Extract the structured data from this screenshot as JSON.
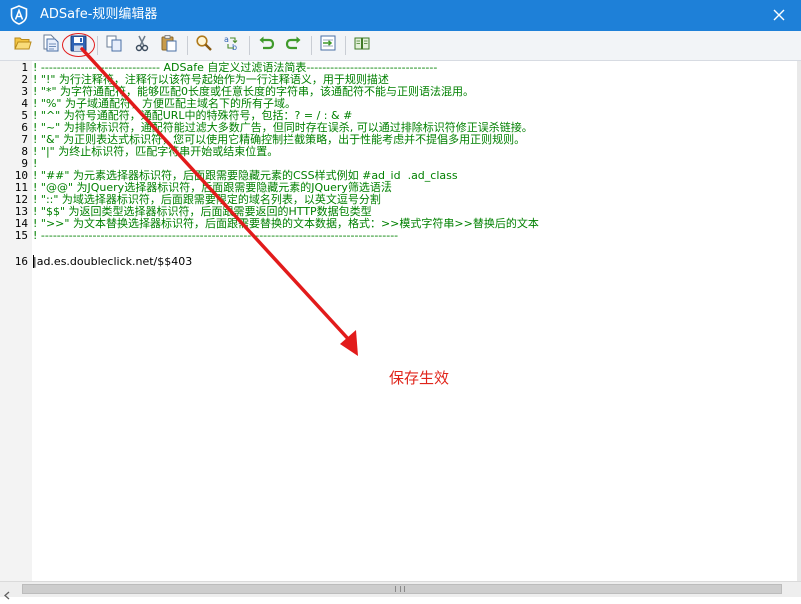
{
  "window": {
    "title": "ADSafe-规则编辑器",
    "titlebar_color": "#1e80d8"
  },
  "toolbar": {
    "buttons": [
      {
        "name": "open-folder-icon"
      },
      {
        "name": "new-document-icon"
      },
      {
        "name": "save-icon"
      },
      {
        "name": "copy-icon"
      },
      {
        "name": "cut-icon"
      },
      {
        "name": "paste-icon"
      },
      {
        "name": "find-icon"
      },
      {
        "name": "replace-icon"
      },
      {
        "name": "undo-icon"
      },
      {
        "name": "redo-icon"
      },
      {
        "name": "goto-line-icon"
      },
      {
        "name": "help-book-icon"
      }
    ]
  },
  "editor": {
    "comment_color": "#008000",
    "text_color": "#000000",
    "lines": [
      {
        "n": "1",
        "text": "! ------------------------------ ADSafe 自定义过滤语法简表---------------------------------"
      },
      {
        "n": "2",
        "text": "! \"!\" 为行注释符，注释行以该符号起始作为一行注释语义，用于规则描述"
      },
      {
        "n": "3",
        "text": "! \"*\" 为字符通配符，能够匹配0长度或任意长度的字符串，该通配符不能与正则语法混用。"
      },
      {
        "n": "4",
        "text": "! \"%\" 为子域通配符，方便匹配主域名下的所有子域。"
      },
      {
        "n": "5",
        "text": "! \"^\" 为符号通配符，通配URL中的特殊符号，包括：? = / : & #"
      },
      {
        "n": "6",
        "text": "! \"~\" 为排除标识符，通配符能过滤大多数广告，但同时存在误杀, 可以通过排除标识符修正误杀链接。"
      },
      {
        "n": "7",
        "text": "! \"&\" 为正则表达式标识符，您可以使用它精确控制拦截策略，出于性能考虑并不提倡多用正则规则。"
      },
      {
        "n": "8",
        "text": "! \"|\" 为终止标识符，匹配字符串开始或结束位置。"
      },
      {
        "n": "9",
        "text": "!"
      },
      {
        "n": "10",
        "text": "! \"##\" 为元素选择器标识符，后面跟需要隐藏元素的CSS样式例如 #ad_id  .ad_class"
      },
      {
        "n": "11",
        "text": "! \"@@\" 为JQuery选择器标识符，后面跟需要隐藏元素的JQuery筛选语法"
      },
      {
        "n": "12",
        "text": "! \"::\" 为域选择器标识符，后面跟需要限定的域名列表，以英文逗号分割"
      },
      {
        "n": "13",
        "text": "! \"$$\" 为返回类型选择器标识符，后面跟需要返回的HTTP数据包类型"
      },
      {
        "n": "14",
        "text": "! \">>\" 为文本替换选择器标识符，后面跟需要替换的文本数据，格式：>>模式字符串>>替换后的文本"
      },
      {
        "n": "15",
        "text": "! ------------------------------------------------------------------------------------------"
      },
      {
        "n": "16",
        "text": "|ad.es.doubleclick.net/$$403"
      }
    ]
  },
  "annotation": {
    "text": "保存生效",
    "color": "#e0251b"
  }
}
